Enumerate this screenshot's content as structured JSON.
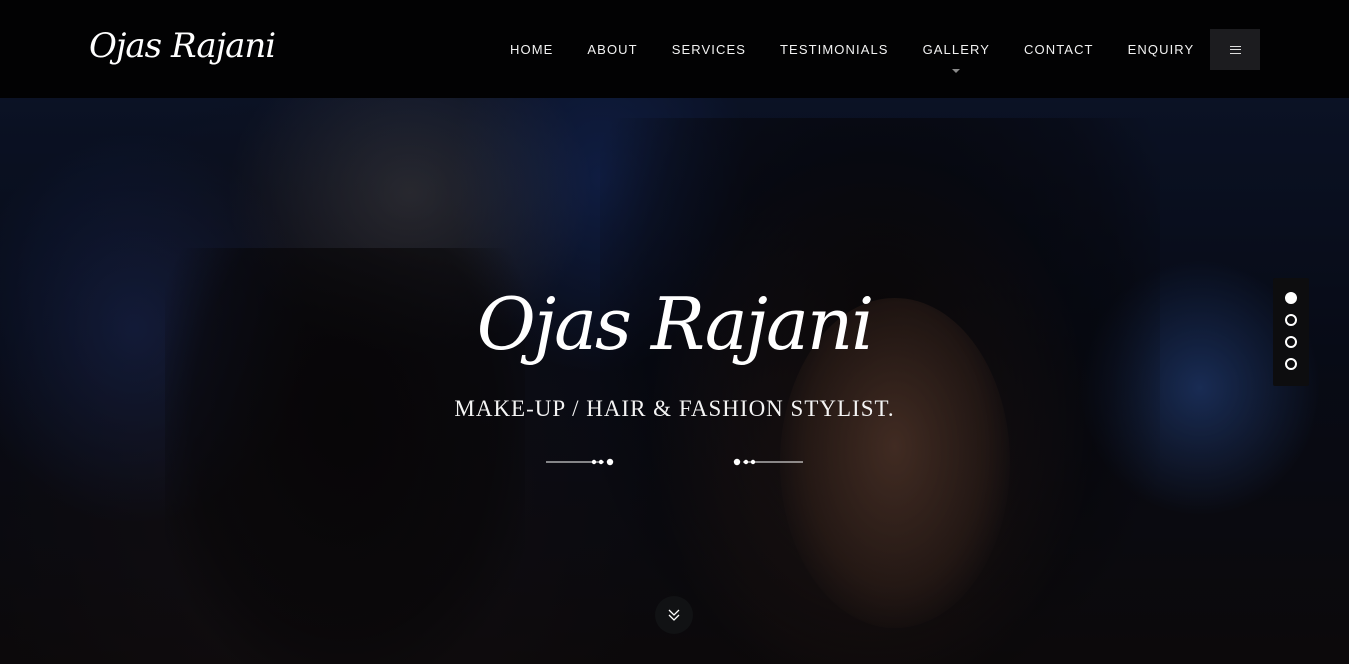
{
  "header": {
    "logo_text": "Ojas Rajani",
    "nav": [
      {
        "label": "HOME"
      },
      {
        "label": "ABOUT"
      },
      {
        "label": "SERVICES"
      },
      {
        "label": "TESTIMONIALS"
      },
      {
        "label": "GALLERY",
        "has_dropdown": true
      },
      {
        "label": "CONTACT"
      },
      {
        "label": "ENQUIRY"
      }
    ],
    "menu_icon": "hamburger-icon"
  },
  "hero": {
    "title": "Ojas Rajani",
    "subtitle": "MAKE-UP / HAIR & FASHION STYLIST.",
    "slides_total": 4,
    "active_slide": 1,
    "scroll_icon": "chevron-double-down-icon"
  },
  "colors": {
    "header_bg": "#020203",
    "text": "#ffffff",
    "menu_button_bg": "#1c1c1f"
  }
}
